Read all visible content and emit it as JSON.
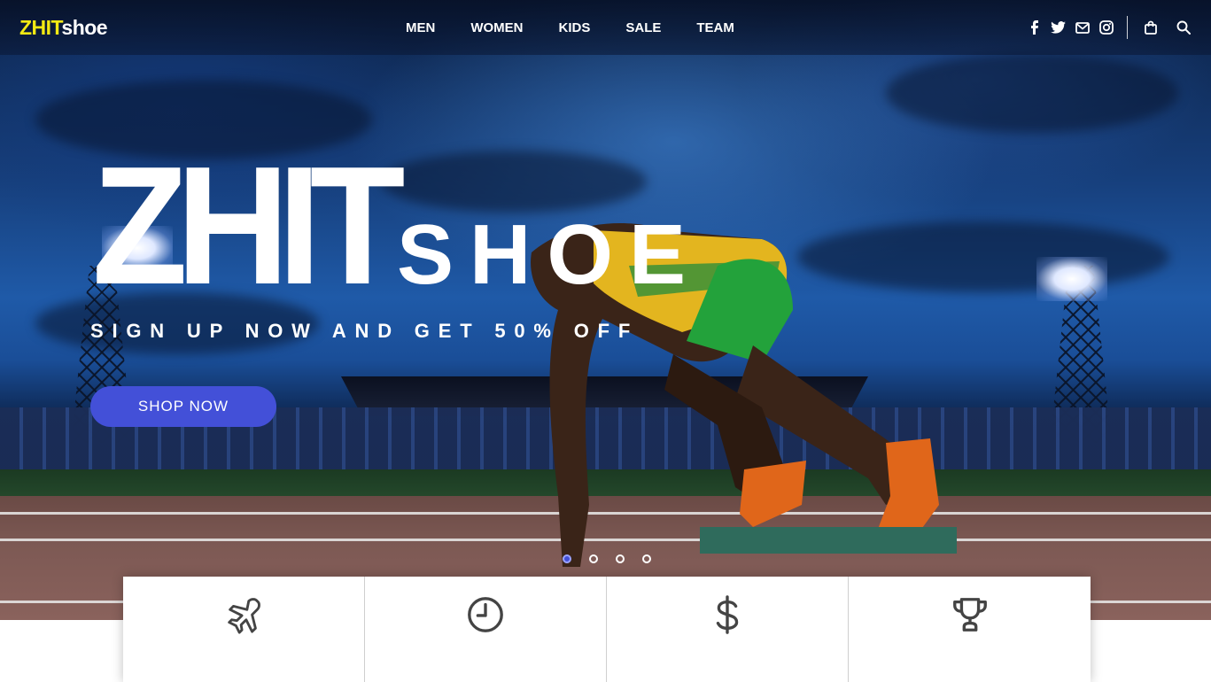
{
  "header": {
    "logo_part1": "ZHIT",
    "logo_part2": "shoe",
    "nav": [
      "MEN",
      "WOMEN",
      "KIDS",
      "SALE",
      "TEAM"
    ],
    "social_icons": [
      "facebook-icon",
      "twitter-icon",
      "mail-icon",
      "instagram-icon"
    ],
    "utility_icons": [
      "shopping-bag-icon",
      "search-icon"
    ]
  },
  "hero": {
    "brand_big": "ZHIT",
    "brand_small": "SHOE",
    "promo": "SIGN UP NOW AND GET 50% OFF",
    "cta_label": "SHOP NOW"
  },
  "slider": {
    "total_slides": 4,
    "active_slide": 1
  },
  "features": {
    "icons": [
      "airplane-icon",
      "clock-icon",
      "dollar-icon",
      "trophy-icon"
    ]
  },
  "colors": {
    "logo_accent": "#f3ea14",
    "primary": "#4350d8",
    "nav_text": "#ffffff"
  }
}
